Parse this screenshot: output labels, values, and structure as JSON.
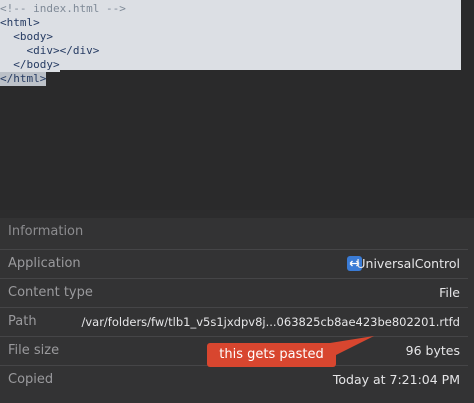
{
  "code_preview": {
    "lines": [
      "<!-- index.html -->",
      "<html>",
      "  <body>",
      "    <div></div>",
      "  </body>",
      "</html>"
    ]
  },
  "information": {
    "header": "Information",
    "rows": [
      {
        "key": "Application",
        "value": "UniversalControl",
        "icon": "universal-control-app-icon"
      },
      {
        "key": "Content type",
        "value": "File"
      },
      {
        "key": "Path",
        "value": "/var/folders/fw/tlb1_v5s1jxdpv8j...063825cb8ae423be802201.rtfd"
      },
      {
        "key": "File size",
        "value": "96 bytes"
      },
      {
        "key": "Copied",
        "value": "Today at 7:21:04 PM"
      }
    ]
  },
  "annotation": {
    "text": "this gets pasted",
    "color": "#d8462f"
  }
}
